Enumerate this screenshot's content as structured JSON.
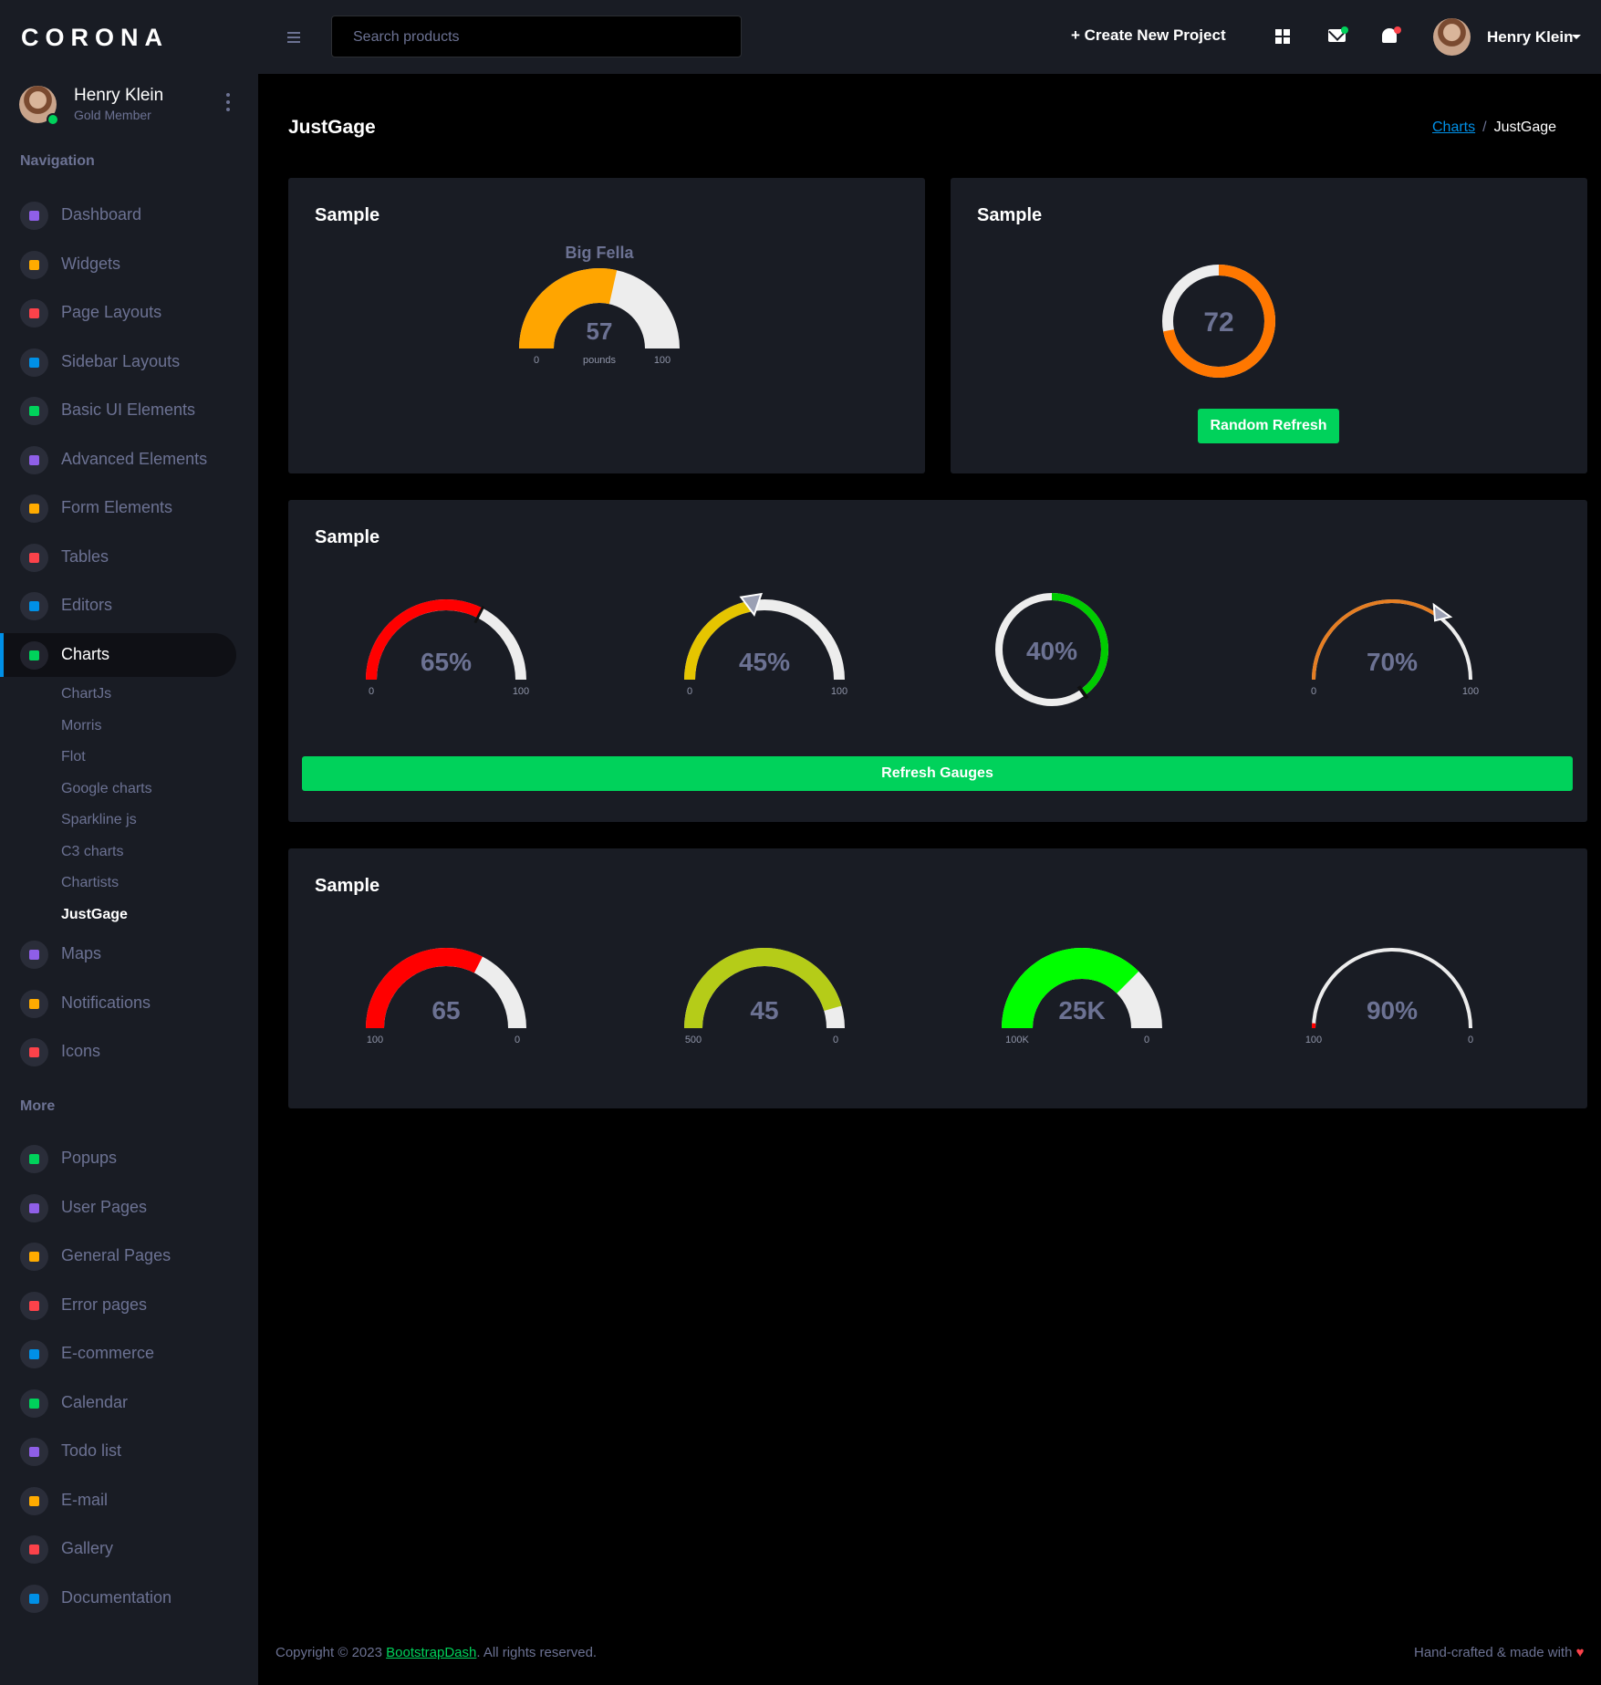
{
  "brand": "CORONA",
  "profile": {
    "name": "Henry Klein",
    "role": "Gold Member"
  },
  "sidebar": {
    "nav_heading": "Navigation",
    "more_heading": "More",
    "items": [
      {
        "label": "Dashboard",
        "icon": "speedometer-icon",
        "color": "#8f5fe8"
      },
      {
        "label": "Widgets",
        "icon": "widgets-icon",
        "color": "#ffab00"
      },
      {
        "label": "Page Layouts",
        "icon": "layout-icon",
        "color": "#fc424a"
      },
      {
        "label": "Sidebar Layouts",
        "icon": "sidebar-icon",
        "color": "#0090e7"
      },
      {
        "label": "Basic UI Elements",
        "icon": "laptop-icon",
        "color": "#00d25b"
      },
      {
        "label": "Advanced Elements",
        "icon": "gear-icon",
        "color": "#8f5fe8"
      },
      {
        "label": "Form Elements",
        "icon": "form-icon",
        "color": "#ffab00"
      },
      {
        "label": "Tables",
        "icon": "table-icon",
        "color": "#fc424a"
      },
      {
        "label": "Editors",
        "icon": "text-icon",
        "color": "#0090e7"
      },
      {
        "label": "Charts",
        "icon": "chart-icon",
        "color": "#00d25b"
      }
    ],
    "chart_subitems": [
      "ChartJs",
      "Morris",
      "Flot",
      "Google charts",
      "Sparkline js",
      "C3 charts",
      "Chartists",
      "JustGage"
    ],
    "items_after": [
      {
        "label": "Maps",
        "icon": "map-pin-icon",
        "color": "#8f5fe8"
      },
      {
        "label": "Notifications",
        "icon": "bell-icon",
        "color": "#ffab00"
      },
      {
        "label": "Icons",
        "icon": "emoticon-icon",
        "color": "#fc424a"
      }
    ],
    "more_items": [
      {
        "label": "Popups",
        "icon": "chat-icon",
        "color": "#00d25b"
      },
      {
        "label": "User Pages",
        "icon": "shield-icon",
        "color": "#8f5fe8"
      },
      {
        "label": "General Pages",
        "icon": "globe-icon",
        "color": "#ffab00"
      },
      {
        "label": "Error pages",
        "icon": "lock-icon",
        "color": "#fc424a"
      },
      {
        "label": "E-commerce",
        "icon": "store-icon",
        "color": "#0090e7"
      },
      {
        "label": "Calendar",
        "icon": "calendar-icon",
        "color": "#00d25b"
      },
      {
        "label": "Todo list",
        "icon": "todo-icon",
        "color": "#8f5fe8"
      },
      {
        "label": "E-mail",
        "icon": "email-icon",
        "color": "#ffab00"
      },
      {
        "label": "Gallery",
        "icon": "gallery-icon",
        "color": "#fc424a"
      },
      {
        "label": "Documentation",
        "icon": "document-icon",
        "color": "#0090e7"
      }
    ]
  },
  "topbar": {
    "search_placeholder": "Search products",
    "create_label": "+ Create New Project",
    "user_name": "Henry Klein"
  },
  "page": {
    "title": "JustGage",
    "breadcrumb_link": "Charts",
    "breadcrumb_current": "JustGage"
  },
  "cards": {
    "card1_title": "Sample",
    "card2_title": "Sample",
    "card3_title": "Sample",
    "card4_title": "Sample",
    "random_refresh": "Random Refresh",
    "refresh_gauges": "Refresh Gauges"
  },
  "chart_data": [
    {
      "type": "gauge",
      "title": "Big Fella",
      "value": 57,
      "min": 0,
      "max": 100,
      "label": "pounds",
      "color": "#ffa500"
    },
    {
      "type": "donut-gauge",
      "value": 72,
      "min": 0,
      "max": 100,
      "color": "#ff7700"
    },
    {
      "type": "gauge",
      "value": 65,
      "display": "65%",
      "min": 0,
      "max": 100,
      "color": "#ff0000",
      "pointer": "needle"
    },
    {
      "type": "gauge",
      "value": 45,
      "display": "45%",
      "min": 0,
      "max": 100,
      "color": "#e5c500",
      "pointer": "triangle"
    },
    {
      "type": "donut-gauge",
      "value": 40,
      "display": "40%",
      "min": 0,
      "max": 100,
      "color": "#00cc00",
      "pointer": "needle"
    },
    {
      "type": "gauge",
      "value": 70,
      "display": "70%",
      "min": 0,
      "max": 100,
      "color": "#e67e22",
      "pointer": "triangle"
    },
    {
      "type": "gauge-reverse",
      "value": 65,
      "display": "65",
      "min_label": "100",
      "max_label": "0",
      "min": 0,
      "max": 100,
      "color": "#ff0000"
    },
    {
      "type": "gauge-reverse",
      "value": 455,
      "display": "45",
      "min_label": "500",
      "max_label": "0",
      "min": 0,
      "max": 500,
      "color": "#b5cc18"
    },
    {
      "type": "gauge-reverse",
      "value": 75,
      "display": "25K",
      "min_label": "100K",
      "max_label": "0",
      "min": 0,
      "max": 100,
      "color": "#00ff00"
    },
    {
      "type": "gauge-reverse",
      "value": 2,
      "display": "90%",
      "min_label": "100",
      "max_label": "0",
      "min": 0,
      "max": 100,
      "color": "#ff0000"
    }
  ],
  "footer": {
    "prefix": "Copyright © 2023 ",
    "link": "BootstrapDash",
    "suffix": ". All rights reserved.",
    "right": "Hand-crafted & made with"
  }
}
